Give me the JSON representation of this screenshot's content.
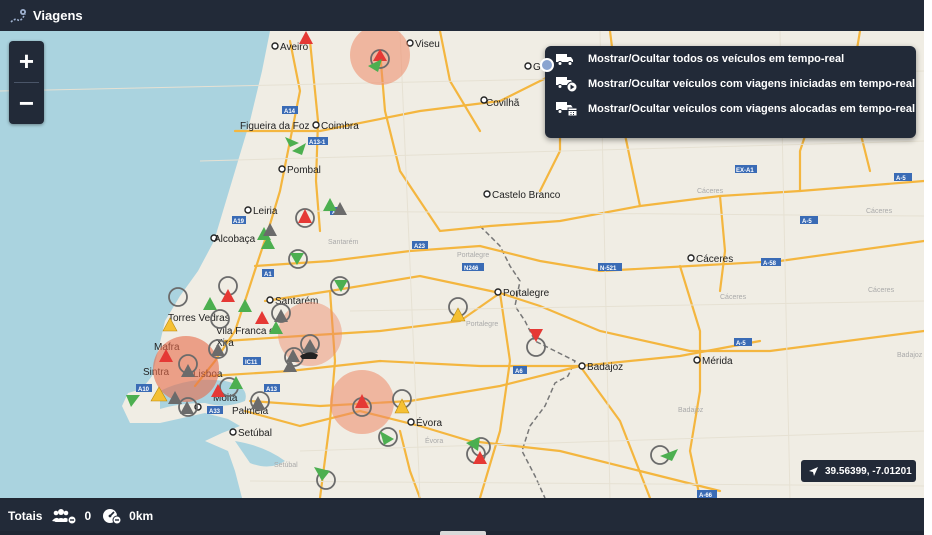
{
  "header": {
    "title": "Viagens"
  },
  "zoom": {
    "in_label": "+",
    "out_label": "−"
  },
  "panel": {
    "items": [
      {
        "label": "Mostrar/Ocultar todos os veículos em tempo-real",
        "icon": "truck-icon"
      },
      {
        "label": "Mostrar/Ocultar veículos com viagens iniciadas em tempo-real",
        "icon": "truck-play-icon"
      },
      {
        "label": "Mostrar/Ocultar veículos com viagens alocadas em tempo-real",
        "icon": "truck-calendar-icon"
      }
    ]
  },
  "coords": {
    "text": "39.56399, -7.01201"
  },
  "footer": {
    "label": "Totais",
    "count": "0",
    "distance": "0km"
  },
  "map": {
    "cities": [
      "Aveiro",
      "Viseu",
      "Guarda",
      "Covilhã",
      "Figueira da Foz",
      "Coimbra",
      "Pombal",
      "Castelo Branco",
      "Leiria",
      "Alcobaça",
      "Santarém",
      "Portalegre",
      "Cáceres",
      "Torres Vedras",
      "Vila Franca de",
      "Xira",
      "Mafra",
      "Sintra",
      "Lisboa",
      "Moita",
      "Palmela",
      "Setúbal",
      "Évora",
      "Badajoz",
      "Mérida"
    ],
    "faint": [
      "Santarém",
      "Portalegre",
      "Portalegre",
      "Cáceres",
      "Cáceres",
      "Cáceres",
      "Cáceres",
      "Badajoz",
      "Badajoz",
      "Setúbal",
      "Évora"
    ],
    "roads": [
      "A14",
      "A13-1",
      "A19",
      "A1",
      "A23",
      "N246",
      "N-521",
      "EX-A1",
      "A-5",
      "A-58",
      "A-5",
      "IC11",
      "A13",
      "A33",
      "A6",
      "A-5",
      "A-66",
      "A10"
    ]
  },
  "colors": {
    "panel_bg": "#222a38",
    "map_bg": "#f0ede4",
    "sea": "#aad3df",
    "road": "#f4b63f",
    "red": "#e53935",
    "green": "#4caf50",
    "yellow": "#f5c033",
    "gray": "#6b6b6b",
    "cluster": "#ee8866"
  }
}
